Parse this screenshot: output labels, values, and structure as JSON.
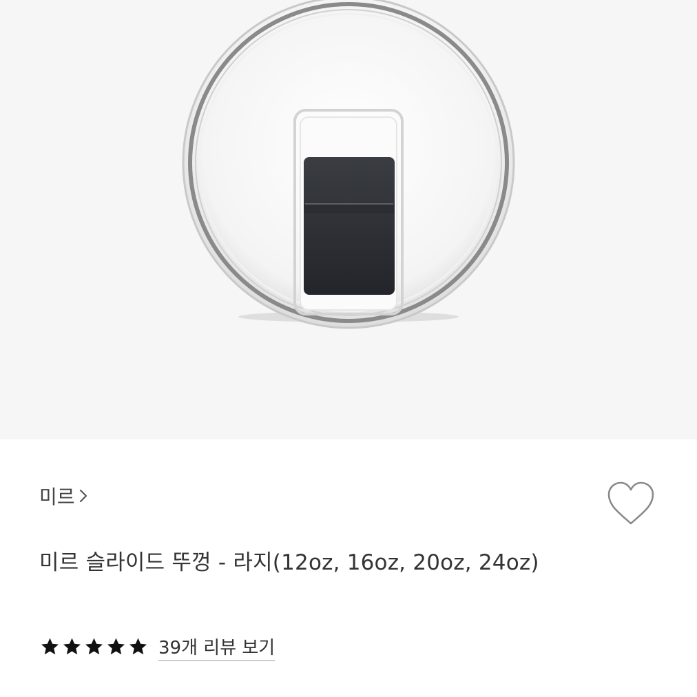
{
  "product": {
    "image_alt": "slide lid product image",
    "brand": "미르",
    "brand_chevron_icon": "chevron-right-icon",
    "wishlist_icon": "heart-outline-icon",
    "title": "미르 슬라이드 뚜껑 - 라지(12oz, 16oz, 20oz, 24oz)",
    "rating": 5,
    "rating_max": 5,
    "star_icon": "star-filled-icon",
    "star_color": "#111111",
    "review_link": "39개 리뷰 보기"
  },
  "colors": {
    "hero_bg": "#f6f6f6",
    "text": "#333333",
    "heart_stroke": "#888888"
  }
}
